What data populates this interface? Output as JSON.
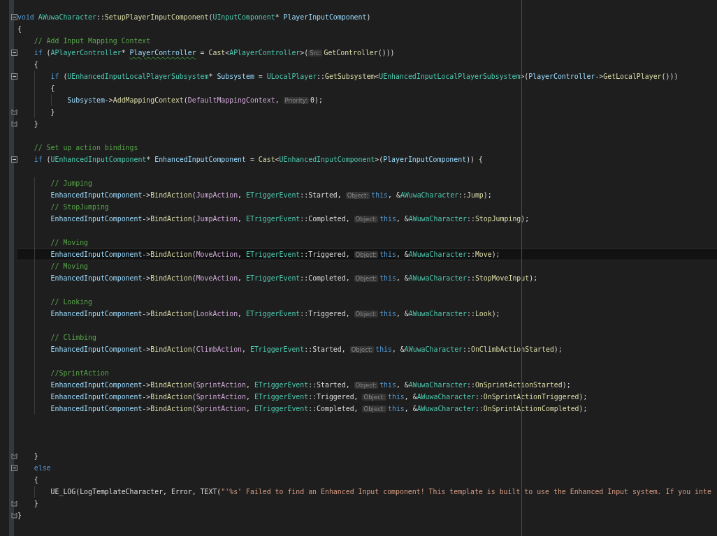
{
  "editor": {
    "lines": [
      {
        "kind": "start",
        "current": false,
        "tokens": [
          {
            "kind": "k",
            "text": "void "
          },
          {
            "kind": "t",
            "text": "AWuwaCharacter"
          },
          {
            "kind": "p",
            "text": "::"
          },
          {
            "kind": "f",
            "text": "SetupPlayerInputComponent"
          },
          {
            "kind": "p",
            "text": "("
          },
          {
            "kind": "t",
            "text": "UInputComponent"
          },
          {
            "kind": "p",
            "text": "* "
          },
          {
            "kind": "v",
            "text": "PlayerInputComponent"
          },
          {
            "kind": "p",
            "text": ")"
          }
        ]
      },
      {
        "kind": "plain",
        "current": false,
        "tokens": [
          {
            "kind": "p",
            "text": "{"
          }
        ]
      },
      {
        "kind": "plain",
        "current": false,
        "tokens": [
          {
            "kind": "c",
            "text": "    // Add Input Mapping Context"
          }
        ]
      },
      {
        "kind": "start",
        "current": false,
        "tokens": [
          {
            "kind": "k",
            "text": "    if"
          },
          {
            "kind": "p",
            "text": " ("
          },
          {
            "kind": "t",
            "text": "APlayerController"
          },
          {
            "kind": "p",
            "text": "* "
          },
          {
            "kind": "v",
            "text": "PlayerController",
            "squiggle": true
          },
          {
            "kind": "p",
            "text": " = "
          },
          {
            "kind": "f",
            "text": "Cast"
          },
          {
            "kind": "p",
            "text": "<"
          },
          {
            "kind": "t",
            "text": "APlayerController"
          },
          {
            "kind": "p",
            "text": ">("
          },
          {
            "kind": "h",
            "text": "Src:"
          },
          {
            "kind": "f",
            "text": "GetController"
          },
          {
            "kind": "p",
            "text": "()))"
          }
        ]
      },
      {
        "kind": "plain",
        "current": false,
        "tokens": [
          {
            "kind": "p",
            "text": "    {"
          }
        ]
      },
      {
        "kind": "start",
        "current": false,
        "tokens": [
          {
            "kind": "k",
            "text": "        if"
          },
          {
            "kind": "p",
            "text": " ("
          },
          {
            "kind": "t",
            "text": "UEnhancedInputLocalPlayerSubsystem"
          },
          {
            "kind": "p",
            "text": "* "
          },
          {
            "kind": "v",
            "text": "Subsystem"
          },
          {
            "kind": "p",
            "text": " = "
          },
          {
            "kind": "t",
            "text": "ULocalPlayer"
          },
          {
            "kind": "p",
            "text": "::"
          },
          {
            "kind": "f",
            "text": "GetSubsystem"
          },
          {
            "kind": "p",
            "text": "<"
          },
          {
            "kind": "t",
            "text": "UEnhancedInputLocalPlayerSubsystem"
          },
          {
            "kind": "p",
            "text": ">("
          },
          {
            "kind": "v",
            "text": "PlayerController"
          },
          {
            "kind": "p",
            "text": "->"
          },
          {
            "kind": "f",
            "text": "GetLocalPlayer"
          },
          {
            "kind": "p",
            "text": "()))"
          }
        ]
      },
      {
        "kind": "plain",
        "current": false,
        "tokens": [
          {
            "kind": "p",
            "text": "        {"
          }
        ]
      },
      {
        "kind": "plain",
        "current": false,
        "tokens": [
          {
            "kind": "v",
            "text": "            Subsystem"
          },
          {
            "kind": "p",
            "text": "->"
          },
          {
            "kind": "f",
            "text": "AddMappingContext"
          },
          {
            "kind": "p",
            "text": "("
          },
          {
            "kind": "m",
            "text": "DefaultMappingContext"
          },
          {
            "kind": "p",
            "text": ", "
          },
          {
            "kind": "h",
            "text": "Priority:"
          },
          {
            "kind": "p",
            "text": "0);"
          }
        ]
      },
      {
        "kind": "end",
        "current": false,
        "tokens": [
          {
            "kind": "p",
            "text": "        }"
          }
        ]
      },
      {
        "kind": "end",
        "current": false,
        "tokens": [
          {
            "kind": "p",
            "text": "    }"
          }
        ]
      },
      {
        "kind": "plain",
        "current": false
      },
      {
        "kind": "plain",
        "current": false,
        "tokens": [
          {
            "kind": "c",
            "text": "    // Set up action bindings"
          }
        ]
      },
      {
        "kind": "start",
        "current": false,
        "tokens": [
          {
            "kind": "k",
            "text": "    if"
          },
          {
            "kind": "p",
            "text": " ("
          },
          {
            "kind": "t",
            "text": "UEnhancedInputComponent"
          },
          {
            "kind": "p",
            "text": "* "
          },
          {
            "kind": "v",
            "text": "EnhancedInputComponent"
          },
          {
            "kind": "p",
            "text": " = "
          },
          {
            "kind": "f",
            "text": "Cast"
          },
          {
            "kind": "p",
            "text": "<"
          },
          {
            "kind": "t",
            "text": "UEnhancedInputComponent"
          },
          {
            "kind": "p",
            "text": ">("
          },
          {
            "kind": "v",
            "text": "PlayerInputComponent"
          },
          {
            "kind": "p",
            "text": ")) {"
          }
        ]
      },
      {
        "kind": "plain",
        "current": false
      },
      {
        "kind": "plain",
        "current": false,
        "tokens": [
          {
            "kind": "c",
            "text": "        // Jumping"
          }
        ]
      },
      {
        "kind": "plain",
        "current": false,
        "tokens": [
          {
            "kind": "v",
            "text": "        EnhancedInputComponent"
          },
          {
            "kind": "p",
            "text": "->"
          },
          {
            "kind": "f",
            "text": "BindAction"
          },
          {
            "kind": "p",
            "text": "("
          },
          {
            "kind": "m",
            "text": "JumpAction"
          },
          {
            "kind": "p",
            "text": ", "
          },
          {
            "kind": "t",
            "text": "ETriggerEvent"
          },
          {
            "kind": "p",
            "text": "::Started, "
          },
          {
            "kind": "h",
            "text": "Object:"
          },
          {
            "kind": "k",
            "text": "this"
          },
          {
            "kind": "p",
            "text": ", &"
          },
          {
            "kind": "t",
            "text": "AWuwaCharacter"
          },
          {
            "kind": "p",
            "text": "::"
          },
          {
            "kind": "f",
            "text": "Jump"
          },
          {
            "kind": "p",
            "text": ");"
          }
        ]
      },
      {
        "kind": "plain",
        "current": false,
        "tokens": [
          {
            "kind": "c",
            "text": "        // StopJumping"
          }
        ]
      },
      {
        "kind": "plain",
        "current": false,
        "tokens": [
          {
            "kind": "v",
            "text": "        EnhancedInputComponent"
          },
          {
            "kind": "p",
            "text": "->"
          },
          {
            "kind": "f",
            "text": "BindAction"
          },
          {
            "kind": "p",
            "text": "("
          },
          {
            "kind": "m",
            "text": "JumpAction"
          },
          {
            "kind": "p",
            "text": ", "
          },
          {
            "kind": "t",
            "text": "ETriggerEvent"
          },
          {
            "kind": "p",
            "text": "::Completed, "
          },
          {
            "kind": "h",
            "text": "Object:"
          },
          {
            "kind": "k",
            "text": "this"
          },
          {
            "kind": "p",
            "text": ", &"
          },
          {
            "kind": "t",
            "text": "AWuwaCharacter"
          },
          {
            "kind": "p",
            "text": "::"
          },
          {
            "kind": "f",
            "text": "StopJumping"
          },
          {
            "kind": "p",
            "text": ");"
          }
        ]
      },
      {
        "kind": "plain",
        "current": false
      },
      {
        "kind": "plain",
        "current": false,
        "tokens": [
          {
            "kind": "c",
            "text": "        // Moving"
          }
        ]
      },
      {
        "kind": "plain",
        "current": true,
        "tokens": [
          {
            "kind": "v",
            "text": "        EnhancedInputComponent"
          },
          {
            "kind": "p",
            "text": "->"
          },
          {
            "kind": "f",
            "text": "BindAction"
          },
          {
            "kind": "p",
            "text": "("
          },
          {
            "kind": "m",
            "text": "MoveAction"
          },
          {
            "kind": "p",
            "text": ", "
          },
          {
            "kind": "t",
            "text": "ETriggerEvent"
          },
          {
            "kind": "p",
            "text": "::Triggered, "
          },
          {
            "kind": "h",
            "text": "Object:"
          },
          {
            "kind": "k",
            "text": "this"
          },
          {
            "kind": "p",
            "text": ", &"
          },
          {
            "kind": "t",
            "text": "AWuwaCharacter"
          },
          {
            "kind": "p",
            "text": "::"
          },
          {
            "kind": "f",
            "text": "Move"
          },
          {
            "kind": "p",
            "text": ");"
          }
        ]
      },
      {
        "kind": "plain",
        "current": false,
        "tokens": [
          {
            "kind": "c",
            "text": "        // Moving"
          }
        ]
      },
      {
        "kind": "plain",
        "current": false,
        "tokens": [
          {
            "kind": "v",
            "text": "        EnhancedInputComponent"
          },
          {
            "kind": "p",
            "text": "->"
          },
          {
            "kind": "f",
            "text": "BindAction"
          },
          {
            "kind": "p",
            "text": "("
          },
          {
            "kind": "m",
            "text": "MoveAction"
          },
          {
            "kind": "p",
            "text": ", "
          },
          {
            "kind": "t",
            "text": "ETriggerEvent"
          },
          {
            "kind": "p",
            "text": "::Completed, "
          },
          {
            "kind": "h",
            "text": "Object:"
          },
          {
            "kind": "k",
            "text": "this"
          },
          {
            "kind": "p",
            "text": ", &"
          },
          {
            "kind": "t",
            "text": "AWuwaCharacter"
          },
          {
            "kind": "p",
            "text": "::"
          },
          {
            "kind": "f",
            "text": "StopMoveInput"
          },
          {
            "kind": "p",
            "text": ");"
          }
        ]
      },
      {
        "kind": "plain",
        "current": false
      },
      {
        "kind": "plain",
        "current": false,
        "tokens": [
          {
            "kind": "c",
            "text": "        // Looking"
          }
        ]
      },
      {
        "kind": "plain",
        "current": false,
        "tokens": [
          {
            "kind": "v",
            "text": "        EnhancedInputComponent"
          },
          {
            "kind": "p",
            "text": "->"
          },
          {
            "kind": "f",
            "text": "BindAction"
          },
          {
            "kind": "p",
            "text": "("
          },
          {
            "kind": "m",
            "text": "LookAction"
          },
          {
            "kind": "p",
            "text": ", "
          },
          {
            "kind": "t",
            "text": "ETriggerEvent"
          },
          {
            "kind": "p",
            "text": "::Triggered, "
          },
          {
            "kind": "h",
            "text": "Object:"
          },
          {
            "kind": "k",
            "text": "this"
          },
          {
            "kind": "p",
            "text": ", &"
          },
          {
            "kind": "t",
            "text": "AWuwaCharacter"
          },
          {
            "kind": "p",
            "text": "::"
          },
          {
            "kind": "f",
            "text": "Look"
          },
          {
            "kind": "p",
            "text": ");"
          }
        ]
      },
      {
        "kind": "plain",
        "current": false
      },
      {
        "kind": "plain",
        "current": false,
        "tokens": [
          {
            "kind": "c",
            "text": "        // Climbing"
          }
        ]
      },
      {
        "kind": "plain",
        "current": false,
        "tokens": [
          {
            "kind": "v",
            "text": "        EnhancedInputComponent"
          },
          {
            "kind": "p",
            "text": "->"
          },
          {
            "kind": "f",
            "text": "BindAction"
          },
          {
            "kind": "p",
            "text": "("
          },
          {
            "kind": "m",
            "text": "ClimbAction"
          },
          {
            "kind": "p",
            "text": ", "
          },
          {
            "kind": "t",
            "text": "ETriggerEvent"
          },
          {
            "kind": "p",
            "text": "::Started, "
          },
          {
            "kind": "h",
            "text": "Object:"
          },
          {
            "kind": "k",
            "text": "this"
          },
          {
            "kind": "p",
            "text": ", &"
          },
          {
            "kind": "t",
            "text": "AWuwaCharacter"
          },
          {
            "kind": "p",
            "text": "::"
          },
          {
            "kind": "f",
            "text": "OnClimbActionStarted"
          },
          {
            "kind": "p",
            "text": ");"
          }
        ]
      },
      {
        "kind": "plain",
        "current": false
      },
      {
        "kind": "plain",
        "current": false,
        "tokens": [
          {
            "kind": "c",
            "text": "        //SprintAction"
          }
        ]
      },
      {
        "kind": "plain",
        "current": false,
        "tokens": [
          {
            "kind": "v",
            "text": "        EnhancedInputComponent"
          },
          {
            "kind": "p",
            "text": "->"
          },
          {
            "kind": "f",
            "text": "BindAction"
          },
          {
            "kind": "p",
            "text": "("
          },
          {
            "kind": "m",
            "text": "SprintAction"
          },
          {
            "kind": "p",
            "text": ", "
          },
          {
            "kind": "t",
            "text": "ETriggerEvent"
          },
          {
            "kind": "p",
            "text": "::Started, "
          },
          {
            "kind": "h",
            "text": "Object:"
          },
          {
            "kind": "k",
            "text": "this"
          },
          {
            "kind": "p",
            "text": ", &"
          },
          {
            "kind": "t",
            "text": "AWuwaCharacter"
          },
          {
            "kind": "p",
            "text": "::"
          },
          {
            "kind": "f",
            "text": "OnSprintActionStarted"
          },
          {
            "kind": "p",
            "text": ");"
          }
        ]
      },
      {
        "kind": "plain",
        "current": false,
        "tokens": [
          {
            "kind": "v",
            "text": "        EnhancedInputComponent"
          },
          {
            "kind": "p",
            "text": "->"
          },
          {
            "kind": "f",
            "text": "BindAction"
          },
          {
            "kind": "p",
            "text": "("
          },
          {
            "kind": "m",
            "text": "SprintAction"
          },
          {
            "kind": "p",
            "text": ", "
          },
          {
            "kind": "t",
            "text": "ETriggerEvent"
          },
          {
            "kind": "p",
            "text": "::Triggered, "
          },
          {
            "kind": "h",
            "text": "Object:"
          },
          {
            "kind": "k",
            "text": "this"
          },
          {
            "kind": "p",
            "text": ", &"
          },
          {
            "kind": "t",
            "text": "AWuwaCharacter"
          },
          {
            "kind": "p",
            "text": "::"
          },
          {
            "kind": "f",
            "text": "OnSprintActionTriggered"
          },
          {
            "kind": "p",
            "text": ");"
          }
        ]
      },
      {
        "kind": "plain",
        "current": false,
        "tokens": [
          {
            "kind": "v",
            "text": "        EnhancedInputComponent"
          },
          {
            "kind": "p",
            "text": "->"
          },
          {
            "kind": "f",
            "text": "BindAction"
          },
          {
            "kind": "p",
            "text": "("
          },
          {
            "kind": "m",
            "text": "SprintAction"
          },
          {
            "kind": "p",
            "text": ", "
          },
          {
            "kind": "t",
            "text": "ETriggerEvent"
          },
          {
            "kind": "p",
            "text": "::Completed, "
          },
          {
            "kind": "h",
            "text": "Object:"
          },
          {
            "kind": "k",
            "text": "this"
          },
          {
            "kind": "p",
            "text": ", &"
          },
          {
            "kind": "t",
            "text": "AWuwaCharacter"
          },
          {
            "kind": "p",
            "text": "::"
          },
          {
            "kind": "f",
            "text": "OnSprintActionCompleted"
          },
          {
            "kind": "p",
            "text": ");"
          }
        ]
      },
      {
        "kind": "plain",
        "current": false
      },
      {
        "kind": "plain",
        "current": false
      },
      {
        "kind": "plain",
        "current": false
      },
      {
        "kind": "end",
        "current": false,
        "tokens": [
          {
            "kind": "p",
            "text": "    }"
          }
        ]
      },
      {
        "kind": "start",
        "current": false,
        "tokens": [
          {
            "kind": "k",
            "text": "    else"
          }
        ]
      },
      {
        "kind": "plain",
        "current": false,
        "tokens": [
          {
            "kind": "p",
            "text": "    {"
          }
        ]
      },
      {
        "kind": "plain",
        "current": false,
        "tokens": [
          {
            "kind": "p",
            "text": "        UE_LOG(LogTemplateCharacter, Error, TEXT("
          },
          {
            "kind": "s",
            "text": "\"'%s' Failed to find an Enhanced Input component! This template is built to use the Enhanced Input system. If you inte"
          }
        ]
      },
      {
        "kind": "end",
        "current": false,
        "tokens": [
          {
            "kind": "p",
            "text": "    }"
          }
        ]
      },
      {
        "kind": "end",
        "current": false,
        "tokens": [
          {
            "kind": "p",
            "text": "}"
          }
        ]
      }
    ]
  }
}
